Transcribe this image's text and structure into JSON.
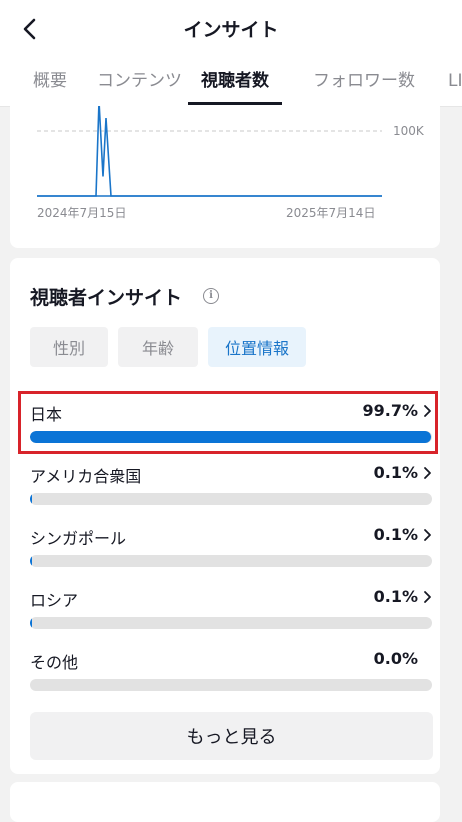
{
  "header": {
    "title": "インサイト"
  },
  "tabs": [
    {
      "label": "概要"
    },
    {
      "label": "コンテンツ"
    },
    {
      "label": "視聴者数"
    },
    {
      "label": "フォロワー数"
    },
    {
      "label": "LI"
    }
  ],
  "active_tab": "視聴者数",
  "chart": {
    "y_tick_label": "100K",
    "x_start_label": "2024年7月15日",
    "x_end_label": "2025年7月14日",
    "line_color": "#1a75c9"
  },
  "chart_data": {
    "type": "line",
    "title": "",
    "x": [
      "2024年7月15日",
      "2025年7月14日"
    ],
    "yticks": [
      "100K"
    ],
    "series": [
      {
        "values": [
          0,
          0,
          150000,
          30000,
          120000,
          0,
          0,
          0,
          0,
          0
        ]
      }
    ]
  },
  "insights": {
    "title": "視聴者インサイト",
    "info_icon": "info-icon",
    "chips": [
      {
        "label": "性別",
        "active": false
      },
      {
        "label": "年齢",
        "active": false
      },
      {
        "label": "位置情報",
        "active": true
      }
    ],
    "locations": [
      {
        "name": "日本",
        "value": "99.7%",
        "fraction": 0.997,
        "has_chevron": true
      },
      {
        "name": "アメリカ合衆国",
        "value": "0.1%",
        "fraction": 0.001,
        "has_chevron": true
      },
      {
        "name": "シンガポール",
        "value": "0.1%",
        "fraction": 0.001,
        "has_chevron": true
      },
      {
        "name": "ロシア",
        "value": "0.1%",
        "fraction": 0.001,
        "has_chevron": true
      },
      {
        "name": "その他",
        "value": "0.0%",
        "fraction": 0.0,
        "has_chevron": false
      }
    ],
    "more_label": "もっと見る"
  },
  "colors": {
    "accent": "#0b74d6",
    "highlight": "#d8232a",
    "chip_active_bg": "#e8f3fc",
    "chip_active_text": "#1a75c9"
  }
}
